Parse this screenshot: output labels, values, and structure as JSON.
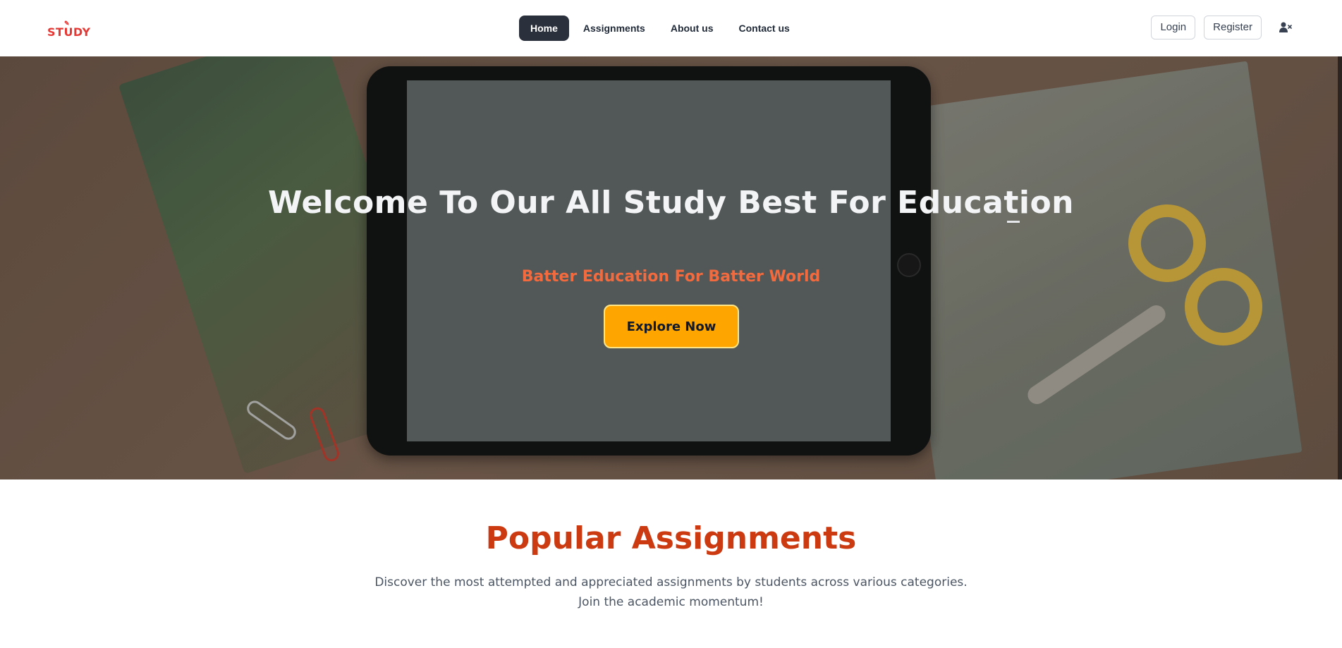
{
  "logo": {
    "mark": "✎",
    "text": "STUDY"
  },
  "nav": {
    "links": [
      {
        "label": "Home",
        "active": true
      },
      {
        "label": "Assignments",
        "active": false
      },
      {
        "label": "About us",
        "active": false
      },
      {
        "label": "Contact us",
        "active": false
      }
    ],
    "login_label": "Login",
    "register_label": "Register",
    "user_icon": "user-x-icon"
  },
  "hero": {
    "title": "Welcome To Our All Study Best For Education",
    "subtitle": "Batter Education For Batter World",
    "cta_label": "Explore Now"
  },
  "popular": {
    "title": "Popular Assignments",
    "desc_line1": "Discover the most attempted and appreciated assignments by students across various categories.",
    "desc_line2": "Join the academic momentum!"
  },
  "colors": {
    "accent_orange": "#ffa500",
    "heading_red": "#cc3a12",
    "subtitle_orange": "#f26a3d",
    "logo_red": "#e53935",
    "nav_active_bg": "#2a303c"
  }
}
